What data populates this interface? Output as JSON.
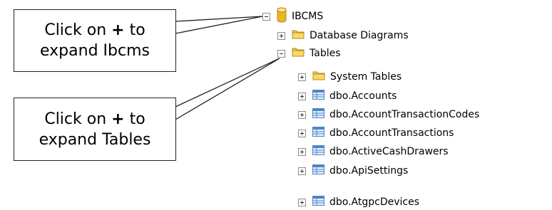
{
  "tree": {
    "root": {
      "label": "IBCMS",
      "icon": "database-icon",
      "expander": "minus"
    },
    "children": [
      {
        "label": "Database Diagrams",
        "icon": "folder-icon",
        "expander": "plus"
      },
      {
        "label": "Tables",
        "icon": "folder-icon",
        "expander": "minus"
      }
    ],
    "tables": [
      {
        "label": "System Tables",
        "icon": "folder-icon",
        "expander": "plus"
      },
      {
        "label": "dbo.Accounts",
        "icon": "table-icon",
        "expander": "plus"
      },
      {
        "label": "dbo.AccountTransactionCodes",
        "icon": "table-icon",
        "expander": "plus"
      },
      {
        "label": "dbo.AccountTransactions",
        "icon": "table-icon",
        "expander": "plus"
      },
      {
        "label": "dbo.ActiveCashDrawers",
        "icon": "table-icon",
        "expander": "plus"
      },
      {
        "label": "dbo.ApiSettings",
        "icon": "table-icon",
        "expander": "plus"
      },
      {
        "label": "dbo.AtgpcDevices",
        "icon": "table-icon",
        "expander": "plus"
      }
    ]
  },
  "callouts": [
    {
      "line1_prefix": "Click on ",
      "line1_bold": "+",
      "line1_suffix": " to",
      "line2": "expand Ibcms"
    },
    {
      "line1_prefix": "Click on ",
      "line1_bold": "+",
      "line1_suffix": " to",
      "line2": "expand Tables"
    }
  ],
  "colors": {
    "folder": "#f0c84a",
    "database": "#e8b62a",
    "table": "#4a86c8",
    "callout_border": "#222222"
  }
}
